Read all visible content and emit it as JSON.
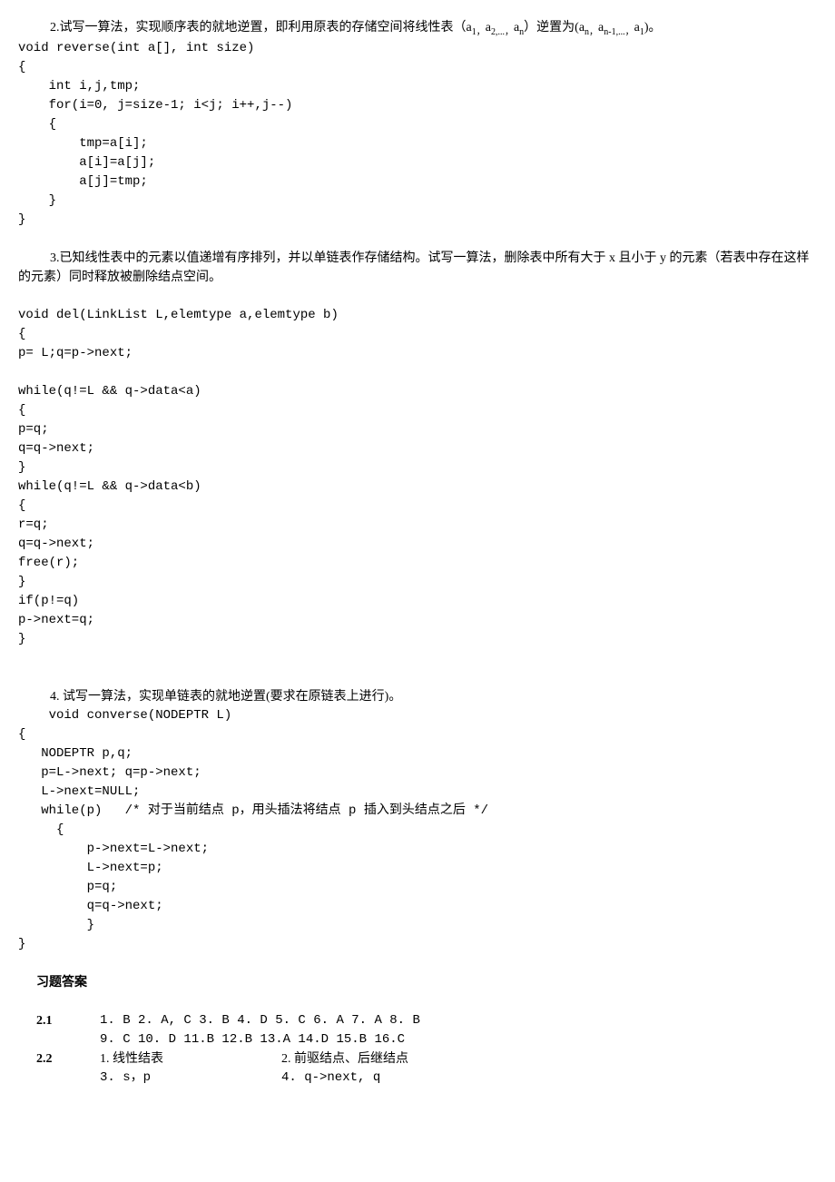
{
  "q2": {
    "title_pre": "2.试写一算法，实现顺序表的就地逆置，即利用原表的存储空间将线性表（a",
    "sub1": "1，",
    "a2": "a",
    "sub2": "2,...，",
    "an": "a",
    "subn": "n",
    "title_mid": "）逆置为(a",
    "subn2": "n，",
    "an1": "a",
    "subn1": "n-1,...，",
    "a1b": "a",
    "sub1b": "1",
    "title_end": ")。",
    "code": [
      "void reverse(int a[], int size)",
      "{",
      "    int i,j,tmp;",
      "    for(i=0, j=size-1; i<j; i++,j--)",
      "    {",
      "        tmp=a[i];",
      "        a[i]=a[j];",
      "        a[j]=tmp;",
      "    }",
      "}"
    ]
  },
  "q3": {
    "title": "3.已知线性表中的元素以值递增有序排列，并以单链表作存储结构。试写一算法，删除表中所有大于 x 且小于 y 的元素（若表中存在这样的元素）同时释放被删除结点空间。",
    "code": [
      "void del(LinkList L,elemtype a,elemtype b)",
      "{",
      "p= L;q=p->next;",
      "",
      "while(q!=L && q->data<a)",
      "{",
      "p=q;",
      "q=q->next;",
      "}",
      "while(q!=L && q->data<b)",
      "{",
      "r=q;",
      "q=q->next;",
      "free(r);",
      "}",
      "if(p!=q)",
      "p->next=q;",
      "}"
    ]
  },
  "q4": {
    "title": "4. 试写一算法，实现单链表的就地逆置(要求在原链表上进行)。",
    "code": [
      "    void converse(NODEPTR L)",
      "{",
      "   NODEPTR p,q;",
      "   p=L->next; q=p->next;",
      "   L->next=NULL;",
      "   while(p)   /* 对于当前结点 p，用头插法将结点 p 插入到头结点之后 */",
      "     {",
      "         p->next=L->next;",
      "         L->next=p;",
      "         p=q;",
      "         q=q->next;",
      "         }",
      "}"
    ]
  },
  "answers": {
    "header": "习题答案",
    "sec21": "2.1",
    "sec21_line1": "1. B    2. A, C   3. B    4. D    5. C    6. A   7. A    8. B",
    "sec21_line2": "9. C    10. D   11.B    12.B    13.A    14.D     15.B    16.C",
    "sec22": "2.2",
    "sec22_1": "1. 线性结表",
    "sec22_2": "2. 前驱结点、后继结点",
    "sec22_3": "3.  s，p",
    "sec22_4": "4.  q->next,  q"
  }
}
